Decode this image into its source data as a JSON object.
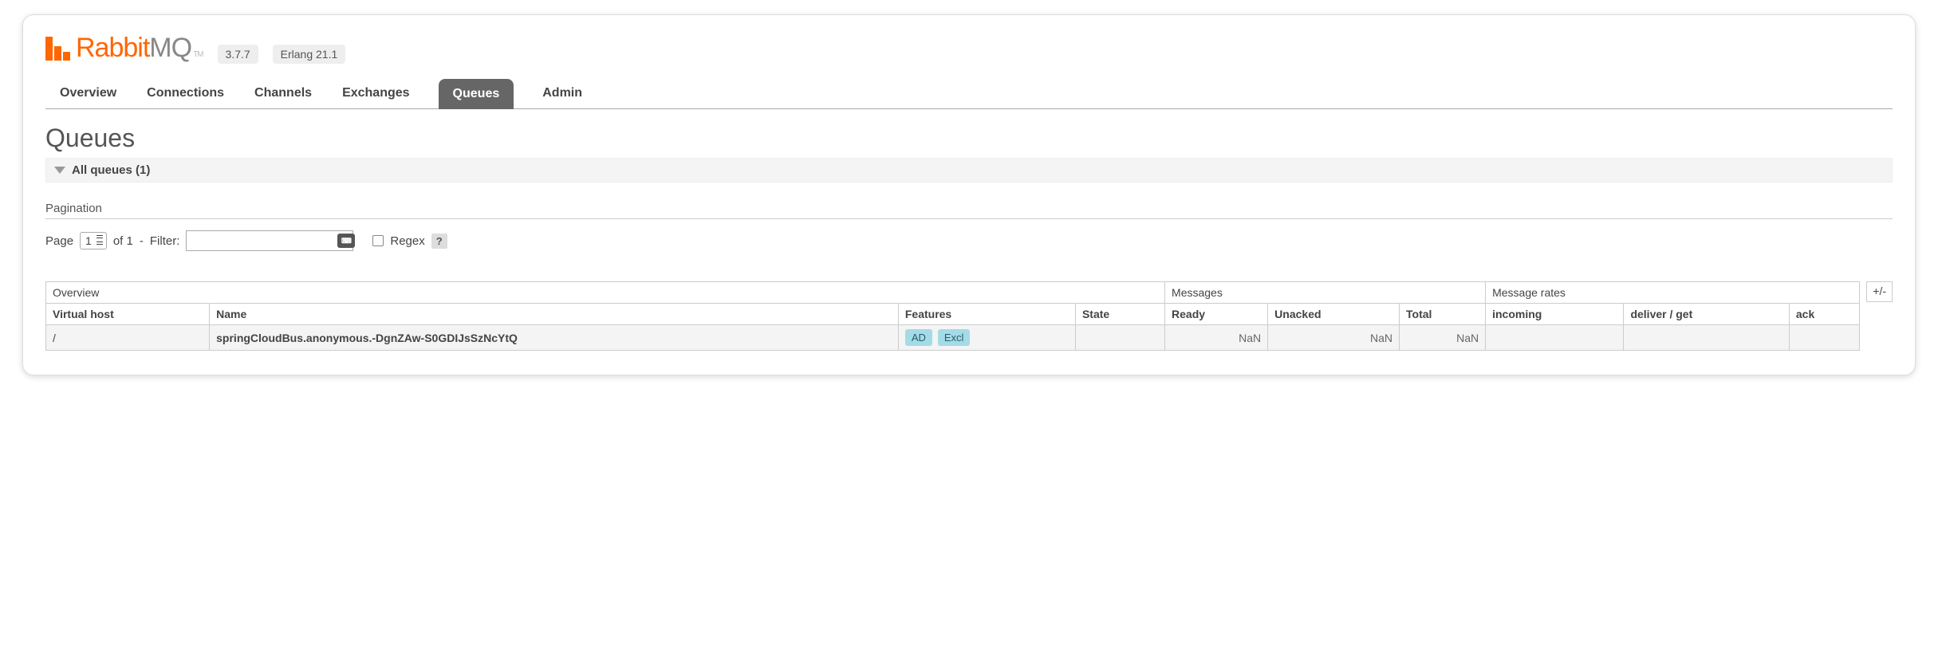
{
  "header": {
    "logo_text_accent": "Rabbit",
    "logo_text_rest": "MQ",
    "logo_tm": "TM",
    "version": "3.7.7",
    "erlang": "Erlang 21.1"
  },
  "nav": {
    "items": [
      "Overview",
      "Connections",
      "Channels",
      "Exchanges",
      "Queues",
      "Admin"
    ],
    "active": "Queues"
  },
  "page": {
    "title": "Queues",
    "section_label": "All queues (1)"
  },
  "pagination": {
    "heading": "Pagination",
    "page_label": "Page",
    "page_value": "1",
    "of_label": "of 1",
    "dash": "-",
    "filter_label": "Filter:",
    "regex_label": "Regex",
    "help": "?"
  },
  "table": {
    "group_headers": [
      "Overview",
      "Messages",
      "Message rates"
    ],
    "sub_headers": [
      "Virtual host",
      "Name",
      "Features",
      "State",
      "Ready",
      "Unacked",
      "Total",
      "incoming",
      "deliver / get",
      "ack"
    ],
    "toggle": "+/-",
    "rows": [
      {
        "vhost": "/",
        "name": "springCloudBus.anonymous.-DgnZAw-S0GDIJsSzNcYtQ",
        "features": [
          "AD",
          "Excl"
        ],
        "state": "",
        "ready": "NaN",
        "unacked": "NaN",
        "total": "NaN",
        "incoming": "",
        "deliver_get": "",
        "ack": ""
      }
    ]
  }
}
